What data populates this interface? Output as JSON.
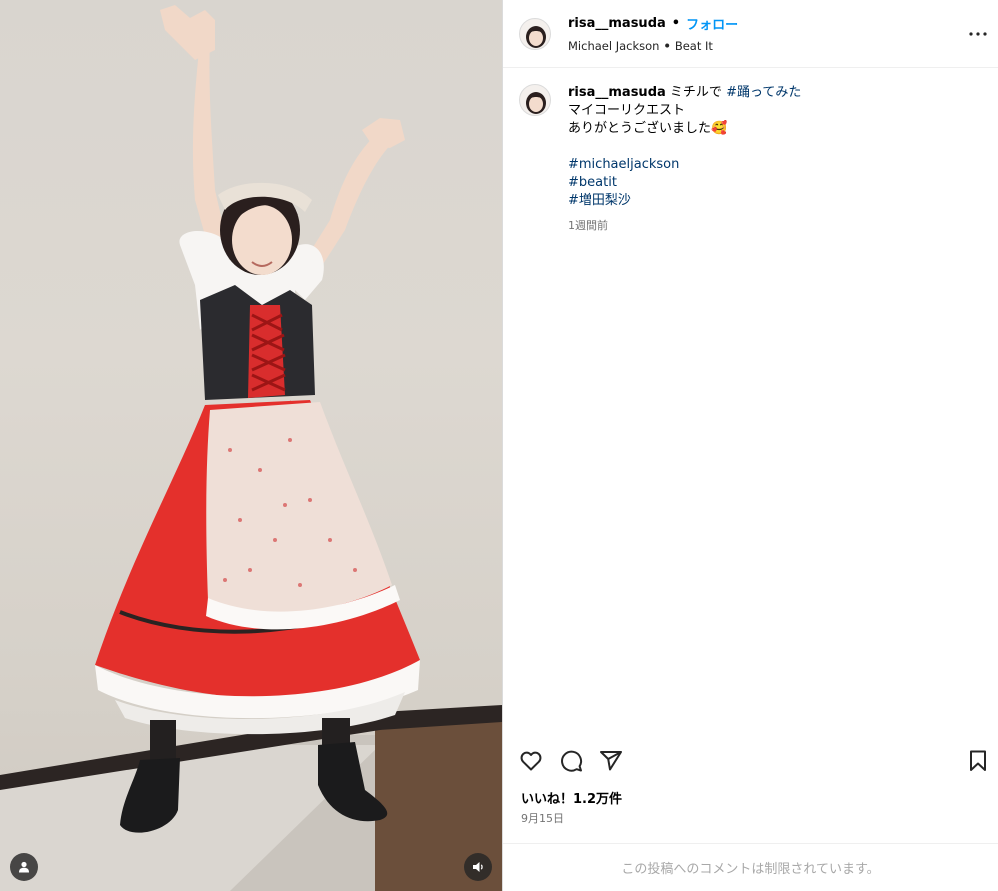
{
  "header": {
    "username": "risa__masuda",
    "separator": "•",
    "follow_label": "フォロー",
    "audio_artist": "Michael Jackson",
    "audio_title": "Beat It"
  },
  "caption": {
    "username": "risa__masuda",
    "text_prefix": "ミチルで",
    "hashtag_dance": "#踊ってみた",
    "line2": "マイコーリクエスト",
    "line3": "ありがとうございました",
    "emoji": "🥰",
    "hashtags": [
      "#michaeljackson",
      "#beatit",
      "#増田梨沙"
    ],
    "time_ago": "1週間前"
  },
  "engagement": {
    "likes_text": "いいね！1.2万件",
    "date_text": "9月15日"
  },
  "comments": {
    "restricted_text": "この投稿へのコメントは制限されています。"
  },
  "icons": {
    "more": "more-options-icon",
    "like": "heart-icon",
    "comment": "comment-icon",
    "share": "share-icon",
    "save": "bookmark-icon",
    "tag": "user-tag-icon",
    "sound": "speaker-icon"
  },
  "colors": {
    "link": "#00376b",
    "follow": "#0095f6",
    "muted": "#737373"
  }
}
